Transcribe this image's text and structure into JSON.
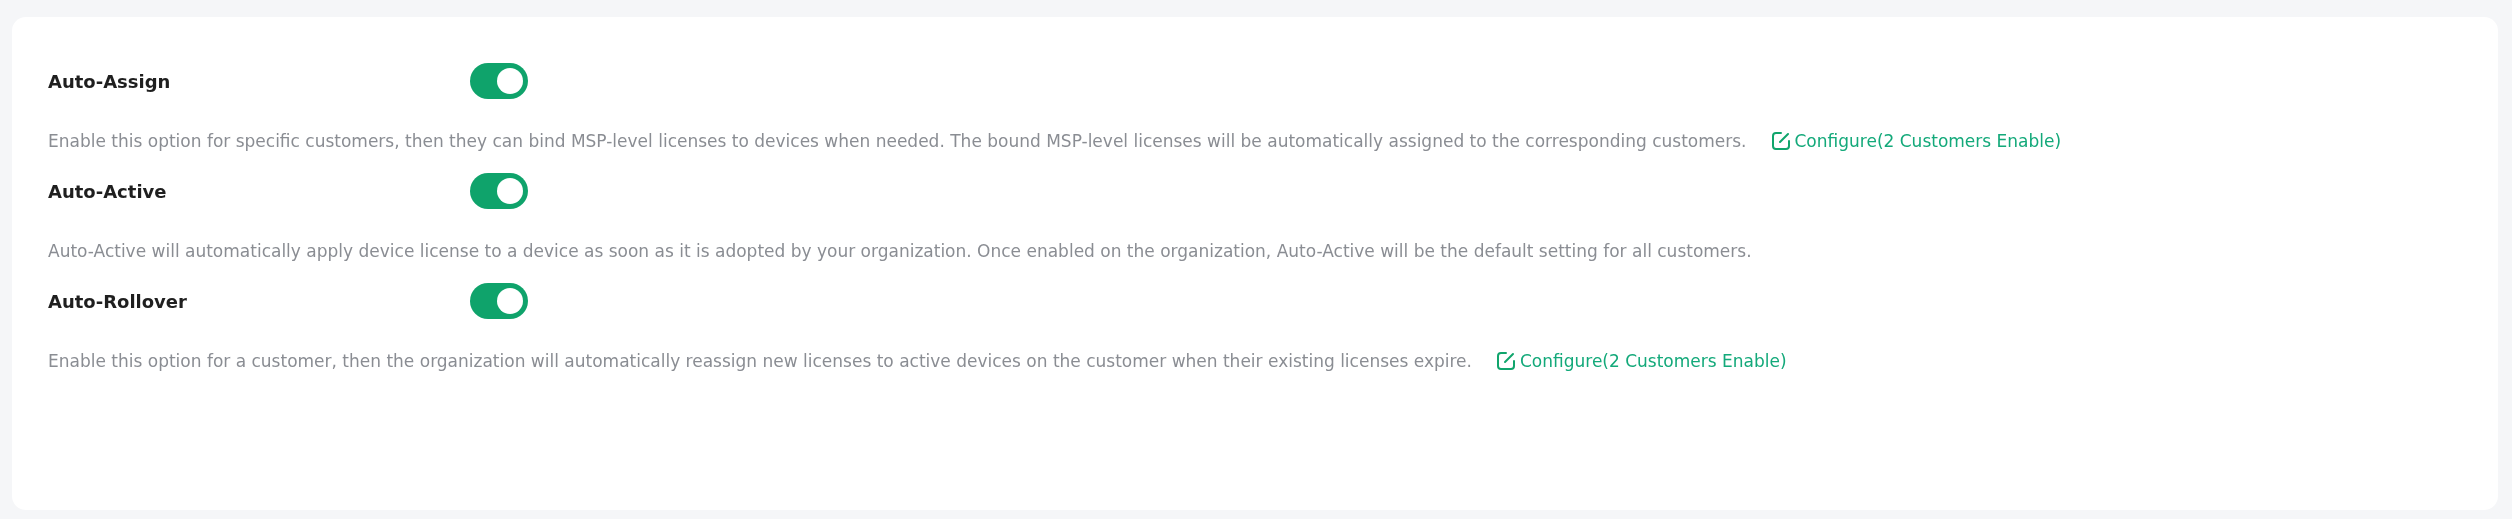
{
  "settings": [
    {
      "title": "Auto-Assign",
      "on": true,
      "description": "Enable this option for specific customers, then they can bind MSP-level licenses to devices when needed. The bound MSP-level licenses will be automatically assigned to the corresponding customers.",
      "link": "Configure(2 Customers Enable)"
    },
    {
      "title": "Auto-Active",
      "on": true,
      "description": "Auto-Active will automatically apply device license to a device as soon as it is adopted by your organization. Once enabled on the organization, Auto-Active will be the default setting for all customers."
    },
    {
      "title": "Auto-Rollover",
      "on": true,
      "description": "Enable this option for a customer, then the organization will automatically reassign new licenses to active devices on the customer when their existing licenses expire.",
      "link": "Configure(2 Customers Enable)"
    }
  ]
}
